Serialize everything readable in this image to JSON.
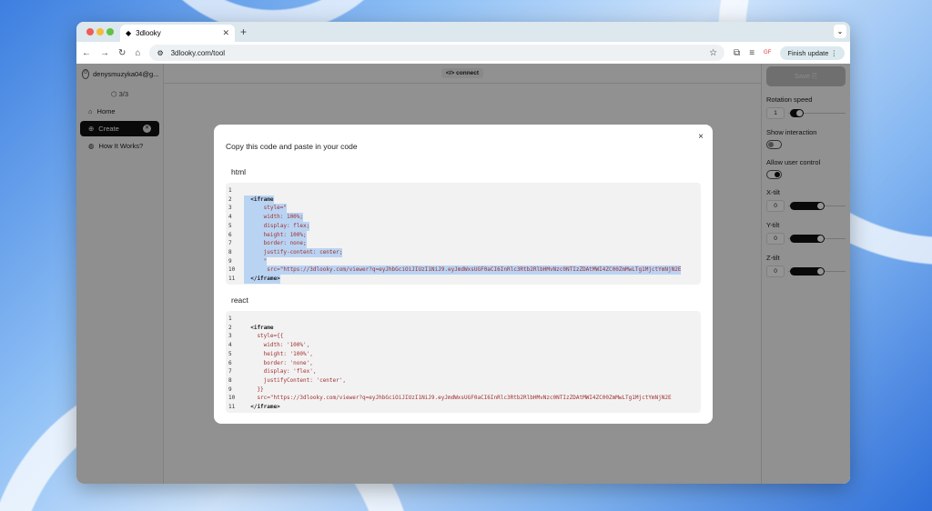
{
  "browser": {
    "tab_title": "3dlooky",
    "url": "3dlooky.com/tool",
    "finish_update": "Finish update",
    "ext_badge": "GF"
  },
  "sidebar": {
    "user": "denysmuzyka04@g...",
    "credits": "3/3",
    "items": [
      {
        "label": "Home"
      },
      {
        "label": "Create"
      },
      {
        "label": "How It Works?"
      }
    ]
  },
  "topbar": {
    "connect": "connect"
  },
  "panel": {
    "save": "Save",
    "rotation_label": "Rotation speed",
    "rotation_value": "1",
    "rotation_level": 0.1,
    "show_interaction": "Show interaction",
    "show_interaction_on": false,
    "allow_user_control": "Allow user control",
    "allow_user_control_on": true,
    "x_tilt": "X-tilt",
    "x_value": "0",
    "y_tilt": "Y-tilt",
    "y_value": "0",
    "z_tilt": "Z-tilt",
    "z_value": "0"
  },
  "modal": {
    "title": "Copy this code and paste in your code",
    "close": "×",
    "html_label": "html",
    "react_label": "react",
    "html_lines": [
      "",
      "  <iframe",
      "      style=\"",
      "      width: 100%;",
      "      display: flex;",
      "      height: 100%;",
      "      border: none;",
      "      justify-content: center;",
      "      \"",
      "       src=\"https://3dlooky.com/viewer?q=eyJhbGciOiJIUzI1NiJ9.eyJmdWxsUGF0aCI6InRlc3Rtb2RlbHMvNzc0NTIzZDAtMWI4ZC00ZmMwLTg1MjctYmNjN2E",
      "  </iframe>"
    ],
    "react_lines": [
      "",
      "  <iframe",
      "    style={{",
      "      width: '100%',",
      "      height: '100%',",
      "      border: 'none',",
      "      display: 'flex',",
      "      justifyContent: 'center',",
      "    }}",
      "    src=\"https://3dlooky.com/viewer?q=eyJhbGciOiJIUzI1NiJ9.eyJmdWxsUGF0aCI6InRlc3Rtb2RlbHMvNzc0NTIzZDAtMWI4ZC00ZmMwLTg1MjctYmNjN2E",
      "  </iframe>"
    ]
  }
}
